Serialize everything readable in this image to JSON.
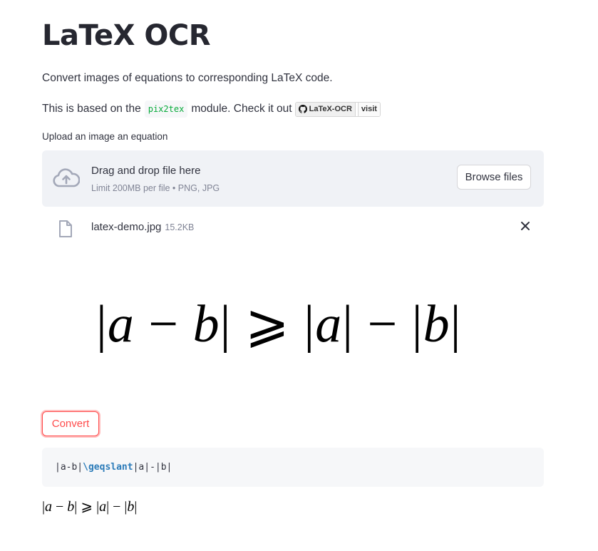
{
  "page": {
    "title": "LaTeX OCR",
    "description": "Convert images of equations to corresponding LaTeX code.",
    "based_on_prefix": "This is based on the",
    "module_name": "pix2tex",
    "based_on_suffix": "module. Check it out",
    "badge_label": "LaTeX-OCR",
    "badge_action": "visit"
  },
  "uploader": {
    "label": "Upload an image an equation",
    "drag_text": "Drag and drop file here",
    "limit_text": "Limit 200MB per file • PNG, JPG",
    "browse_label": "Browse files",
    "file": {
      "name": "latex-demo.jpg",
      "size": "15.2KB"
    }
  },
  "equation_image": {
    "bar1": "|",
    "a": "a",
    "minus1": " − ",
    "b": "b",
    "bar2": "|",
    "geq": " ⩾ ",
    "bar3": "|",
    "a2": "a",
    "bar4": "|",
    "minus2": " − ",
    "bar5": "|",
    "b2": "b",
    "bar6": "|"
  },
  "actions": {
    "convert_label": "Convert"
  },
  "result": {
    "code_prefix": "|a-b|",
    "code_keyword": "\\geqslant",
    "code_suffix": "|a|-|b|",
    "rendered": {
      "p1": "|",
      "a": "a",
      "m1": " − ",
      "b": "b",
      "p2": "| ",
      "geq": "⩾",
      "p3": " |",
      "a2": "a",
      "p4": "|",
      "m2": " − ",
      "p5": "|",
      "b2": "b",
      "p6": "|"
    }
  },
  "colors": {
    "accent": "#ff4b4b",
    "code_keyword": "#2b7bb9",
    "inline_code": "#09ab3b",
    "dropzone_bg": "#f0f2f6"
  }
}
